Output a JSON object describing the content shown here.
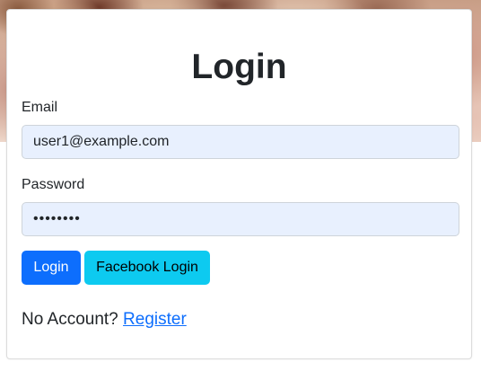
{
  "page": {
    "title": "Login"
  },
  "form": {
    "email_label": "Email",
    "email_value": "user1@example.com",
    "password_label": "Password",
    "password_value": "pass1234",
    "login_button": "Login",
    "facebook_button": "Facebook Login"
  },
  "footer": {
    "prompt": "No Account?",
    "register_link": "Register"
  },
  "colors": {
    "primary": "#0d6efd",
    "info": "#0dcaf0",
    "input_autofill_bg": "#e8f0fe",
    "text": "#212529"
  }
}
